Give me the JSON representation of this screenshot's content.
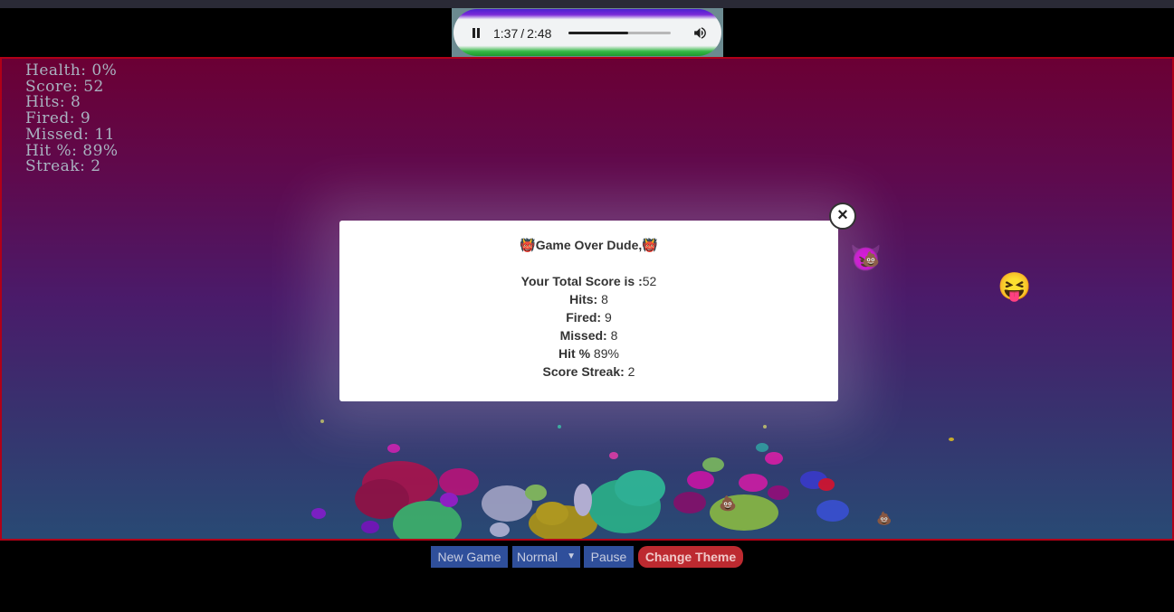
{
  "media_player": {
    "current_time": "1:37",
    "separator": "/",
    "duration": "2:48",
    "progress": 0.58,
    "pause_icon": "pause-icon",
    "volume_icon": "volume-icon"
  },
  "hud": {
    "health": "Health: 0%",
    "score": "Score: 52",
    "hits": "Hits: 8",
    "fired": "Fired: 9",
    "missed": "Missed: 11",
    "hit_pct": "Hit %: 89%",
    "streak": "Streak: 2"
  },
  "modal": {
    "title_emoji": "👹",
    "title": "Game Over Dude,",
    "rows": [
      {
        "label": "Your Total Score is :",
        "value": "52"
      },
      {
        "label": "Hits:",
        "value": " 8"
      },
      {
        "label": "Fired:",
        "value": " 9"
      },
      {
        "label": "Missed:",
        "value": " 8"
      },
      {
        "label": "Hit %",
        "value": " 89%"
      },
      {
        "label": "Score Streak:",
        "value": " 2"
      }
    ],
    "close_label": "×"
  },
  "controls": {
    "new_game": "New Game",
    "difficulty": "Normal",
    "pause": "Pause",
    "change_theme": "Change Theme"
  },
  "colors": {
    "border": "#b00018",
    "button_blue": "#2f4f9b",
    "button_red": "#bd2a30"
  },
  "emojis": {
    "poop": "💩",
    "laughing_face": "😝",
    "devil_face": "😈"
  }
}
